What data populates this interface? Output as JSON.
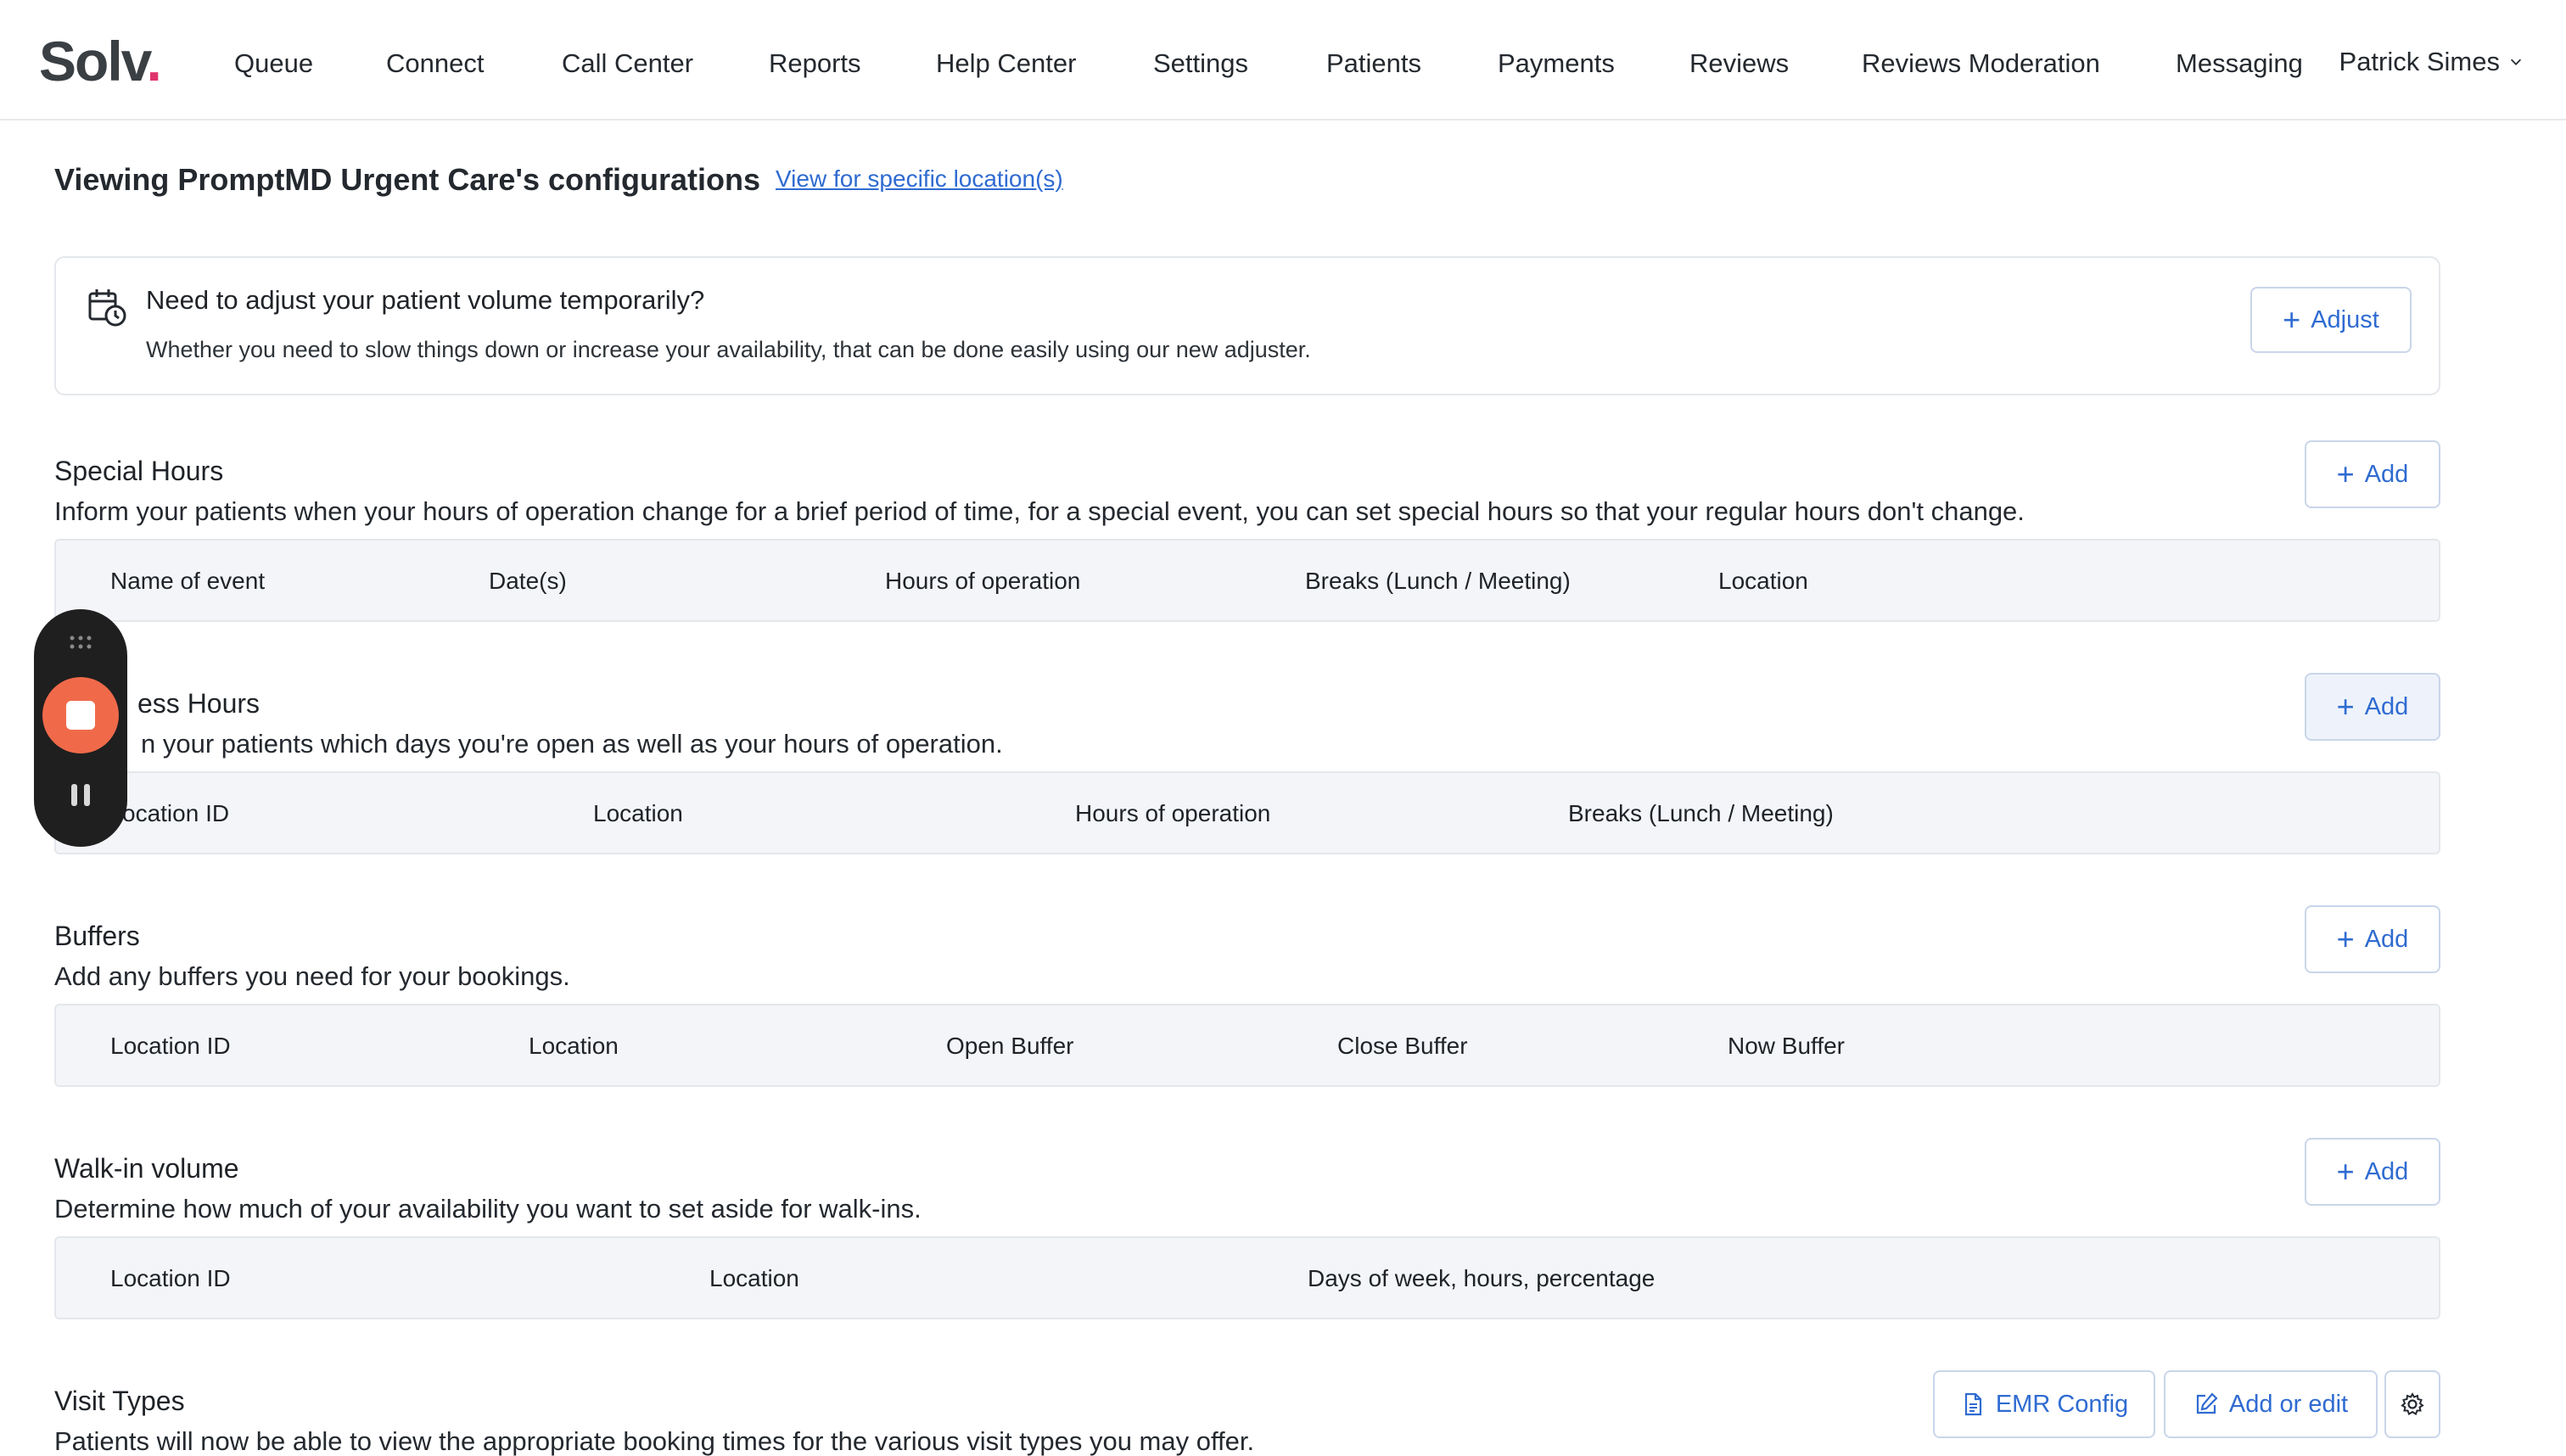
{
  "brand": {
    "logo_main": "Solv",
    "logo_dot": ".",
    "accent": "#e0336b",
    "link_color": "#2f6bd1"
  },
  "nav": {
    "items": [
      {
        "label": "Queue"
      },
      {
        "label": "Connect"
      },
      {
        "label": "Call Center"
      },
      {
        "label": "Reports"
      },
      {
        "label": "Help Center"
      },
      {
        "label": "Settings"
      },
      {
        "label": "Patients"
      },
      {
        "label": "Payments"
      },
      {
        "label": "Reviews"
      },
      {
        "label": "Reviews Moderation"
      },
      {
        "label": "Messaging"
      }
    ],
    "user": {
      "name": "Patrick Simes",
      "icon": "chevron-down-icon"
    }
  },
  "header": {
    "title": "Viewing PromptMD Urgent Care's configurations",
    "link": "View for specific location(s)"
  },
  "adjuster": {
    "icon": "calendar-clock-icon",
    "title": "Need to adjust your patient volume temporarily?",
    "description": "Whether you need to slow things down or increase your availability, that can be done easily using our new adjuster.",
    "button": "Adjust"
  },
  "sections": {
    "special_hours": {
      "title": "Special Hours",
      "description": "Inform your patients when your hours of operation change for a brief period of time, for a special event, you can set special hours so that your regular hours don't change.",
      "add_label": "Add",
      "columns": [
        "Name of event",
        "Date(s)",
        "Hours of operation",
        "Breaks (Lunch / Meeting)",
        "Location"
      ]
    },
    "business_hours": {
      "title": "ess Hours",
      "description": "n your patients which days you're open as well as your hours of operation.",
      "add_label": "Add",
      "columns": [
        "ocation ID",
        "Location",
        "Hours of operation",
        "Breaks (Lunch / Meeting)"
      ]
    },
    "buffers": {
      "title": "Buffers",
      "description": "Add any buffers you need for your bookings.",
      "add_label": "Add",
      "columns": [
        "Location ID",
        "Location",
        "Open Buffer",
        "Close Buffer",
        "Now Buffer"
      ]
    },
    "walk_in": {
      "title": "Walk-in volume",
      "description": "Determine how much of your availability you want to set aside for walk-ins.",
      "add_label": "Add",
      "columns": [
        "Location ID",
        "Location",
        "Days of week, hours, percentage"
      ]
    },
    "visit_types": {
      "title": "Visit Types",
      "description": "Patients will now be able to view the appropriate booking times for the various visit types you may offer.",
      "emr_label": "EMR Config",
      "add_edit_label": "Add or edit",
      "settings_icon": "gear-icon"
    }
  },
  "recorder": {
    "stop_icon": "stop-icon",
    "pause_icon": "pause-icon",
    "grip_icon": "drag-handle-icon",
    "stop_color": "#f06a4a"
  }
}
